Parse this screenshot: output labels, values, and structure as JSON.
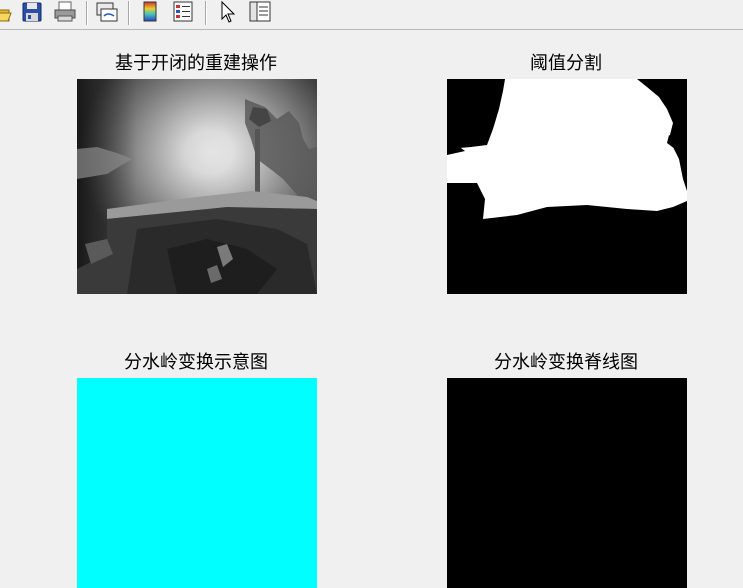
{
  "toolbar": {
    "buttons": [
      "open-file",
      "save-figure",
      "print-figure",
      "link-plot",
      "insert-colorbar",
      "insert-legend",
      "edit-plot",
      "show-plot-tools"
    ]
  },
  "figure": {
    "subplots": [
      {
        "title": "基于开闭的重建操作",
        "content": "grayscale-reconstructed-image"
      },
      {
        "title": "阈值分割",
        "content": "binary-threshold-image"
      },
      {
        "title": "分水岭变换示意图",
        "content": "cyan-filled-label-image"
      },
      {
        "title": "分水岭变换脊线图",
        "content": "black-ridge-line-image"
      }
    ]
  },
  "colors": {
    "background": "#f0f0f0",
    "cyan_fill": "#00ffff",
    "black": "#000000",
    "white": "#ffffff"
  }
}
